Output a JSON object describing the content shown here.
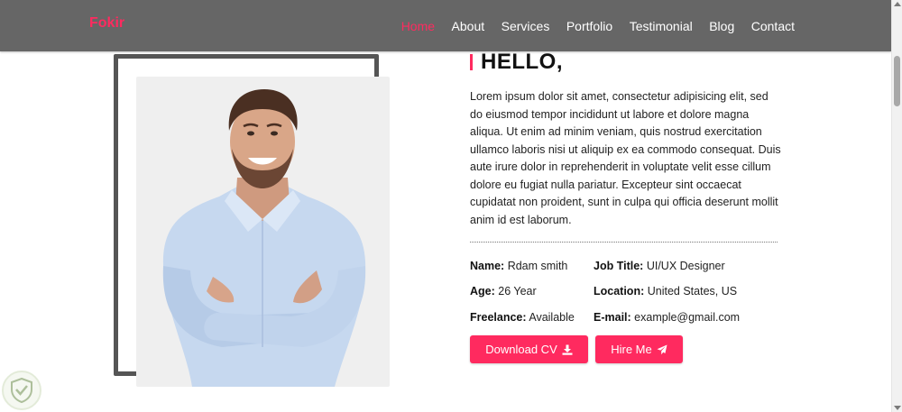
{
  "navbar": {
    "brand": "Fokir",
    "links": [
      {
        "label": "Home",
        "active": true
      },
      {
        "label": "About",
        "active": false
      },
      {
        "label": "Services",
        "active": false
      },
      {
        "label": "Portfolio",
        "active": false
      },
      {
        "label": "Testimonial",
        "active": false
      },
      {
        "label": "Blog",
        "active": false
      },
      {
        "label": "Contact",
        "active": false
      }
    ]
  },
  "about": {
    "heading": "HELLO,",
    "paragraph": "Lorem ipsum dolor sit amet, consectetur adipisicing elit, sed do eiusmod tempor incididunt ut labore et dolore magna aliqua. Ut enim ad minim veniam, quis nostrud exercitation ullamco laboris nisi ut aliquip ex ea commodo consequat. Duis aute irure dolor in reprehenderit in voluptate velit esse cillum dolore eu fugiat nulla pariatur. Excepteur sint occaecat cupidatat non proident, sunt in culpa qui officia deserunt mollit anim id est laborum.",
    "info": {
      "name_label": "Name:",
      "name_value": "Rdam smith",
      "job_label": "Job Title:",
      "job_value": "UI/UX Designer",
      "age_label": "Age:",
      "age_value": "26 Year",
      "location_label": "Location:",
      "location_value": "United States, US",
      "freelance_label": "Freelance:",
      "freelance_value": "Available",
      "email_label": "E-mail:",
      "email_value": "example@gmail.com"
    },
    "buttons": {
      "download_cv": "Download CV",
      "download_icon": "download-icon",
      "hire_me": "Hire Me",
      "hire_icon": "paper-plane-icon"
    }
  },
  "colors": {
    "accent": "#ff2a5f",
    "navbar_bg": "#666666",
    "frame": "#555555",
    "text": "#222222"
  },
  "icons": {
    "photo": "smiling-man-photo",
    "badge": "shield-check-icon"
  }
}
